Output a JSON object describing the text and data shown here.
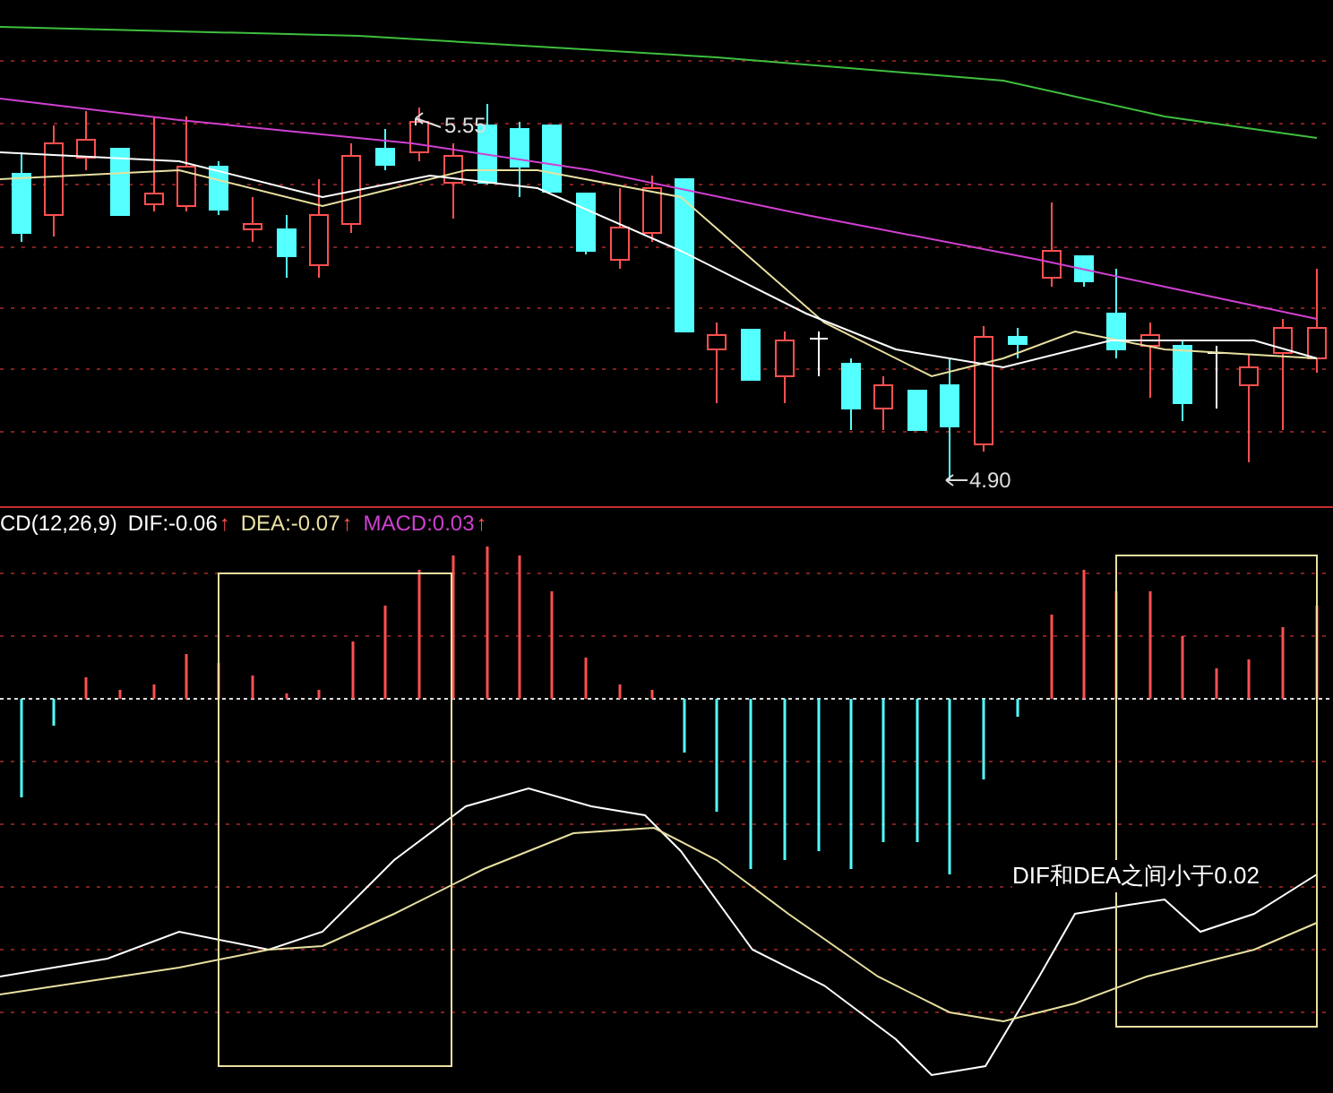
{
  "price_panel": {
    "high_label": "5.55",
    "low_label": "4.90"
  },
  "macd_panel": {
    "legend": [
      {
        "kind": "name",
        "text": "CD(12,26,9)"
      },
      {
        "kind": "dif",
        "text": "DIF:-0.06",
        "arrow": "↑"
      },
      {
        "kind": "dea",
        "text": "DEA:-0.07",
        "arrow": "↑"
      },
      {
        "kind": "macd",
        "text": "MACD:0.03",
        "arrow": "↑"
      }
    ],
    "annotation": "DIF和DEA之间小于0.02"
  }
}
